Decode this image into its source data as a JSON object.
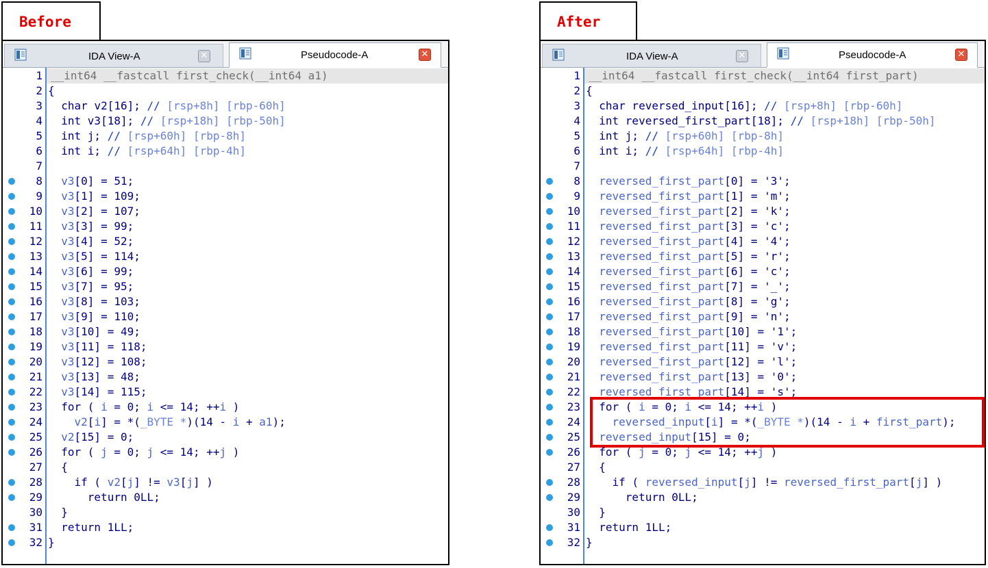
{
  "panels": [
    {
      "label": "Before",
      "tabs": [
        {
          "label": "IDA View-A",
          "close": "✕"
        },
        {
          "label": "Pseudocode-A",
          "close": "✕"
        }
      ],
      "lines": [
        {
          "n": "1",
          "dot": false,
          "hl": true,
          "tokens": [
            [
              "gray",
              "__int64 __fastcall first_check(__int64 a1)"
            ]
          ]
        },
        {
          "n": "2",
          "dot": false,
          "tokens": [
            [
              "kw",
              "{"
            ]
          ]
        },
        {
          "n": "3",
          "dot": false,
          "tokens": [
            [
              "kw",
              "  char "
            ],
            [
              "kw",
              "v2[16]; "
            ],
            [
              "cmt",
              "// "
            ],
            [
              "ann",
              "[rsp+8h] [rbp-60h]"
            ]
          ]
        },
        {
          "n": "4",
          "dot": false,
          "tokens": [
            [
              "kw",
              "  int v3[18]; "
            ],
            [
              "cmt",
              "// "
            ],
            [
              "ann",
              "[rsp+18h] [rbp-50h]"
            ]
          ]
        },
        {
          "n": "5",
          "dot": false,
          "tokens": [
            [
              "kw",
              "  int j; "
            ],
            [
              "cmt",
              "// "
            ],
            [
              "ann",
              "[rsp+60h] [rbp-8h]"
            ]
          ]
        },
        {
          "n": "6",
          "dot": false,
          "tokens": [
            [
              "kw",
              "  int i; "
            ],
            [
              "cmt",
              "// "
            ],
            [
              "ann",
              "[rsp+64h] [rbp-4h]"
            ]
          ]
        },
        {
          "n": "7",
          "dot": false,
          "tokens": []
        },
        {
          "n": "8",
          "dot": true,
          "tokens": [
            [
              "var",
              "  v3"
            ],
            [
              "kw",
              "[0] = 51;"
            ]
          ]
        },
        {
          "n": "9",
          "dot": true,
          "tokens": [
            [
              "var",
              "  v3"
            ],
            [
              "kw",
              "[1] = 109;"
            ]
          ]
        },
        {
          "n": "10",
          "dot": true,
          "tokens": [
            [
              "var",
              "  v3"
            ],
            [
              "kw",
              "[2] = 107;"
            ]
          ]
        },
        {
          "n": "11",
          "dot": true,
          "tokens": [
            [
              "var",
              "  v3"
            ],
            [
              "kw",
              "[3] = 99;"
            ]
          ]
        },
        {
          "n": "12",
          "dot": true,
          "tokens": [
            [
              "var",
              "  v3"
            ],
            [
              "kw",
              "[4] = 52;"
            ]
          ]
        },
        {
          "n": "13",
          "dot": true,
          "tokens": [
            [
              "var",
              "  v3"
            ],
            [
              "kw",
              "[5] = 114;"
            ]
          ]
        },
        {
          "n": "14",
          "dot": true,
          "tokens": [
            [
              "var",
              "  v3"
            ],
            [
              "kw",
              "[6] = 99;"
            ]
          ]
        },
        {
          "n": "15",
          "dot": true,
          "tokens": [
            [
              "var",
              "  v3"
            ],
            [
              "kw",
              "[7] = 95;"
            ]
          ]
        },
        {
          "n": "16",
          "dot": true,
          "tokens": [
            [
              "var",
              "  v3"
            ],
            [
              "kw",
              "[8] = 103;"
            ]
          ]
        },
        {
          "n": "17",
          "dot": true,
          "tokens": [
            [
              "var",
              "  v3"
            ],
            [
              "kw",
              "[9] = 110;"
            ]
          ]
        },
        {
          "n": "18",
          "dot": true,
          "tokens": [
            [
              "var",
              "  v3"
            ],
            [
              "kw",
              "[10] = 49;"
            ]
          ]
        },
        {
          "n": "19",
          "dot": true,
          "tokens": [
            [
              "var",
              "  v3"
            ],
            [
              "kw",
              "[11] = 118;"
            ]
          ]
        },
        {
          "n": "20",
          "dot": true,
          "tokens": [
            [
              "var",
              "  v3"
            ],
            [
              "kw",
              "[12] = 108;"
            ]
          ]
        },
        {
          "n": "21",
          "dot": true,
          "tokens": [
            [
              "var",
              "  v3"
            ],
            [
              "kw",
              "[13] = 48;"
            ]
          ]
        },
        {
          "n": "22",
          "dot": true,
          "tokens": [
            [
              "var",
              "  v3"
            ],
            [
              "kw",
              "[14] = 115;"
            ]
          ]
        },
        {
          "n": "23",
          "dot": true,
          "tokens": [
            [
              "kw",
              "  for ( "
            ],
            [
              "var",
              "i"
            ],
            [
              "kw",
              " = 0; "
            ],
            [
              "var",
              "i"
            ],
            [
              "kw",
              " <= 14; ++"
            ],
            [
              "var",
              "i"
            ],
            [
              "kw",
              " )"
            ]
          ]
        },
        {
          "n": "24",
          "dot": true,
          "tokens": [
            [
              "var",
              "    v2"
            ],
            [
              "kw",
              "["
            ],
            [
              "var",
              "i"
            ],
            [
              "kw",
              "] = *("
            ],
            [
              "ann",
              "_BYTE *"
            ],
            [
              "kw",
              ")(14 - "
            ],
            [
              "var",
              "i"
            ],
            [
              "kw",
              " + "
            ],
            [
              "var",
              "a1"
            ],
            [
              "kw",
              ");"
            ]
          ]
        },
        {
          "n": "25",
          "dot": true,
          "tokens": [
            [
              "var",
              "  v2"
            ],
            [
              "kw",
              "[15] = 0;"
            ]
          ]
        },
        {
          "n": "26",
          "dot": true,
          "tokens": [
            [
              "kw",
              "  for ( "
            ],
            [
              "var",
              "j"
            ],
            [
              "kw",
              " = 0; "
            ],
            [
              "var",
              "j"
            ],
            [
              "kw",
              " <= 14; ++"
            ],
            [
              "var",
              "j"
            ],
            [
              "kw",
              " )"
            ]
          ]
        },
        {
          "n": "27",
          "dot": false,
          "tokens": [
            [
              "kw",
              "  {"
            ]
          ]
        },
        {
          "n": "28",
          "dot": true,
          "tokens": [
            [
              "kw",
              "    if ( "
            ],
            [
              "var",
              "v2"
            ],
            [
              "kw",
              "["
            ],
            [
              "var",
              "j"
            ],
            [
              "kw",
              "] != "
            ],
            [
              "var",
              "v3"
            ],
            [
              "kw",
              "["
            ],
            [
              "var",
              "j"
            ],
            [
              "kw",
              "] )"
            ]
          ]
        },
        {
          "n": "29",
          "dot": true,
          "tokens": [
            [
              "kw",
              "      return 0LL;"
            ]
          ]
        },
        {
          "n": "30",
          "dot": false,
          "tokens": [
            [
              "kw",
              "  }"
            ]
          ]
        },
        {
          "n": "31",
          "dot": true,
          "tokens": [
            [
              "kw",
              "  return 1LL;"
            ]
          ]
        },
        {
          "n": "32",
          "dot": true,
          "tokens": [
            [
              "kw",
              "}"
            ]
          ]
        }
      ]
    },
    {
      "label": "After",
      "tabs": [
        {
          "label": "IDA View-A",
          "close": "✕"
        },
        {
          "label": "Pseudocode-A",
          "close": "✕"
        }
      ],
      "lines": [
        {
          "n": "1",
          "dot": false,
          "hl": true,
          "tokens": [
            [
              "gray",
              "__int64 __fastcall first_check(__int64 first_part)"
            ]
          ]
        },
        {
          "n": "2",
          "dot": false,
          "tokens": [
            [
              "kw",
              "{"
            ]
          ]
        },
        {
          "n": "3",
          "dot": false,
          "tokens": [
            [
              "kw",
              "  char reversed_input[16]; "
            ],
            [
              "cmt",
              "// "
            ],
            [
              "ann",
              "[rsp+8h] [rbp-60h]"
            ]
          ]
        },
        {
          "n": "4",
          "dot": false,
          "tokens": [
            [
              "kw",
              "  int reversed_first_part[18]; "
            ],
            [
              "cmt",
              "// "
            ],
            [
              "ann",
              "[rsp+18h] [rbp-50h]"
            ]
          ]
        },
        {
          "n": "5",
          "dot": false,
          "tokens": [
            [
              "kw",
              "  int j; "
            ],
            [
              "cmt",
              "// "
            ],
            [
              "ann",
              "[rsp+60h] [rbp-8h]"
            ]
          ]
        },
        {
          "n": "6",
          "dot": false,
          "tokens": [
            [
              "kw",
              "  int i; "
            ],
            [
              "cmt",
              "// "
            ],
            [
              "ann",
              "[rsp+64h] [rbp-4h]"
            ]
          ]
        },
        {
          "n": "7",
          "dot": false,
          "tokens": []
        },
        {
          "n": "8",
          "dot": true,
          "tokens": [
            [
              "var",
              "  reversed_first_part"
            ],
            [
              "kw",
              "[0] = '3';"
            ]
          ]
        },
        {
          "n": "9",
          "dot": true,
          "tokens": [
            [
              "var",
              "  reversed_first_part"
            ],
            [
              "kw",
              "[1] = 'm';"
            ]
          ]
        },
        {
          "n": "10",
          "dot": true,
          "tokens": [
            [
              "var",
              "  reversed_first_part"
            ],
            [
              "kw",
              "[2] = 'k';"
            ]
          ]
        },
        {
          "n": "11",
          "dot": true,
          "tokens": [
            [
              "var",
              "  reversed_first_part"
            ],
            [
              "kw",
              "[3] = 'c';"
            ]
          ]
        },
        {
          "n": "12",
          "dot": true,
          "tokens": [
            [
              "var",
              "  reversed_first_part"
            ],
            [
              "kw",
              "[4] = '4';"
            ]
          ]
        },
        {
          "n": "13",
          "dot": true,
          "tokens": [
            [
              "var",
              "  reversed_first_part"
            ],
            [
              "kw",
              "[5] = 'r';"
            ]
          ]
        },
        {
          "n": "14",
          "dot": true,
          "tokens": [
            [
              "var",
              "  reversed_first_part"
            ],
            [
              "kw",
              "[6] = 'c';"
            ]
          ]
        },
        {
          "n": "15",
          "dot": true,
          "tokens": [
            [
              "var",
              "  reversed_first_part"
            ],
            [
              "kw",
              "[7] = '_';"
            ]
          ]
        },
        {
          "n": "16",
          "dot": true,
          "tokens": [
            [
              "var",
              "  reversed_first_part"
            ],
            [
              "kw",
              "[8] = 'g';"
            ]
          ]
        },
        {
          "n": "17",
          "dot": true,
          "tokens": [
            [
              "var",
              "  reversed_first_part"
            ],
            [
              "kw",
              "[9] = 'n';"
            ]
          ]
        },
        {
          "n": "18",
          "dot": true,
          "tokens": [
            [
              "var",
              "  reversed_first_part"
            ],
            [
              "kw",
              "[10] = '1';"
            ]
          ]
        },
        {
          "n": "19",
          "dot": true,
          "tokens": [
            [
              "var",
              "  reversed_first_part"
            ],
            [
              "kw",
              "[11] = 'v';"
            ]
          ]
        },
        {
          "n": "20",
          "dot": true,
          "tokens": [
            [
              "var",
              "  reversed_first_part"
            ],
            [
              "kw",
              "[12] = 'l';"
            ]
          ]
        },
        {
          "n": "21",
          "dot": true,
          "tokens": [
            [
              "var",
              "  reversed_first_part"
            ],
            [
              "kw",
              "[13] = '0';"
            ]
          ]
        },
        {
          "n": "22",
          "dot": true,
          "tokens": [
            [
              "var",
              "  reversed_first_part"
            ],
            [
              "kw",
              "[14] = 's';"
            ]
          ]
        },
        {
          "n": "23",
          "dot": true,
          "tokens": [
            [
              "kw",
              "  for ( "
            ],
            [
              "var",
              "i"
            ],
            [
              "kw",
              " = 0; "
            ],
            [
              "var",
              "i"
            ],
            [
              "kw",
              " <= 14; ++"
            ],
            [
              "var",
              "i"
            ],
            [
              "kw",
              " )"
            ]
          ]
        },
        {
          "n": "24",
          "dot": true,
          "tokens": [
            [
              "var",
              "    reversed_input"
            ],
            [
              "kw",
              "["
            ],
            [
              "var",
              "i"
            ],
            [
              "kw",
              "] = *("
            ],
            [
              "ann",
              "_BYTE *"
            ],
            [
              "kw",
              ")(14 - "
            ],
            [
              "var",
              "i"
            ],
            [
              "kw",
              " + "
            ],
            [
              "var",
              "first_part"
            ],
            [
              "kw",
              ");"
            ]
          ]
        },
        {
          "n": "25",
          "dot": true,
          "tokens": [
            [
              "var",
              "  reversed_input"
            ],
            [
              "kw",
              "[15] = 0;"
            ]
          ]
        },
        {
          "n": "26",
          "dot": true,
          "tokens": [
            [
              "kw",
              "  for ( "
            ],
            [
              "var",
              "j"
            ],
            [
              "kw",
              " = 0; "
            ],
            [
              "var",
              "j"
            ],
            [
              "kw",
              " <= 14; ++"
            ],
            [
              "var",
              "j"
            ],
            [
              "kw",
              " )"
            ]
          ]
        },
        {
          "n": "27",
          "dot": false,
          "tokens": [
            [
              "kw",
              "  {"
            ]
          ]
        },
        {
          "n": "28",
          "dot": true,
          "tokens": [
            [
              "kw",
              "    if ( "
            ],
            [
              "var",
              "reversed_input"
            ],
            [
              "kw",
              "["
            ],
            [
              "var",
              "j"
            ],
            [
              "kw",
              "] != "
            ],
            [
              "var",
              "reversed_first_part"
            ],
            [
              "kw",
              "["
            ],
            [
              "var",
              "j"
            ],
            [
              "kw",
              "] )"
            ]
          ]
        },
        {
          "n": "29",
          "dot": true,
          "tokens": [
            [
              "kw",
              "      return 0LL;"
            ]
          ]
        },
        {
          "n": "30",
          "dot": false,
          "tokens": [
            [
              "kw",
              "  }"
            ]
          ]
        },
        {
          "n": "31",
          "dot": true,
          "tokens": [
            [
              "kw",
              "  return 1LL;"
            ]
          ]
        },
        {
          "n": "32",
          "dot": true,
          "tokens": [
            [
              "kw",
              "}"
            ]
          ]
        }
      ],
      "highlight_lines": [
        "23",
        "25"
      ]
    }
  ],
  "colors": {
    "label_red": "#e00000",
    "breakpoint_blue": "#2f9ee0",
    "code_navy": "#000080",
    "var_blue": "#4a64c8"
  }
}
